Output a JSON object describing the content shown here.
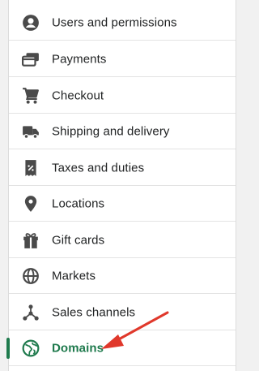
{
  "settings_menu": {
    "items": [
      {
        "label": "Users and permissions",
        "icon": "user-circle-icon"
      },
      {
        "label": "Payments",
        "icon": "credit-card-icon"
      },
      {
        "label": "Checkout",
        "icon": "cart-icon"
      },
      {
        "label": "Shipping and delivery",
        "icon": "truck-icon"
      },
      {
        "label": "Taxes and duties",
        "icon": "tax-receipt-icon"
      },
      {
        "label": "Locations",
        "icon": "location-pin-icon"
      },
      {
        "label": "Gift cards",
        "icon": "gift-icon"
      },
      {
        "label": "Markets",
        "icon": "globe-markets-icon"
      },
      {
        "label": "Sales channels",
        "icon": "channels-icon"
      },
      {
        "label": "Domains",
        "icon": "globe-icon",
        "active": true
      }
    ]
  },
  "colors": {
    "accent": "#1f7a4d",
    "annotation_arrow": "#e0382b",
    "text": "#202223",
    "icon": "#4a4a4a"
  }
}
